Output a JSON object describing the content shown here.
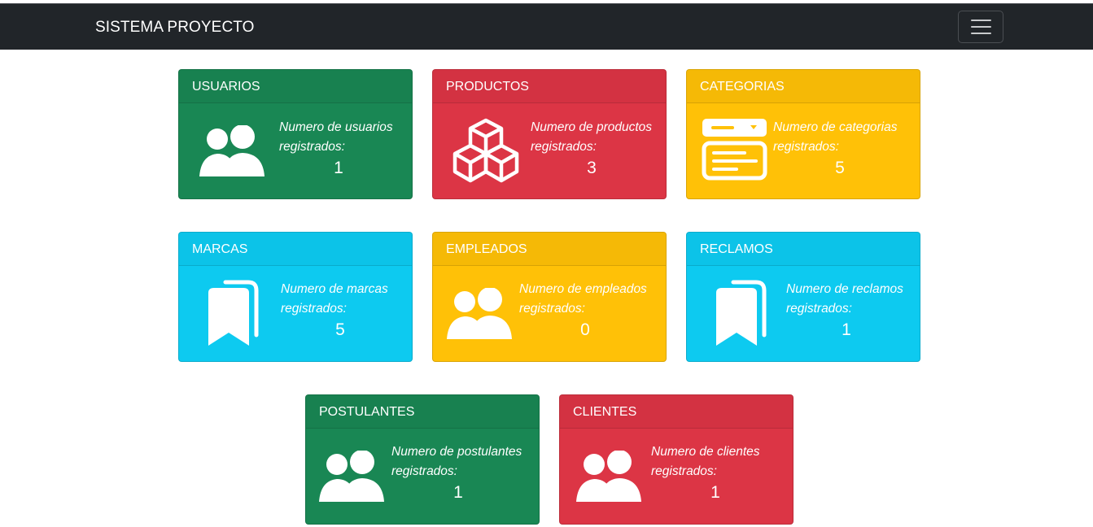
{
  "app": {
    "brand": "SISTEMA PROYECTO",
    "menu_icon": "hamburger-icon"
  },
  "colors": {
    "navbar": "#212529",
    "green": "#198754",
    "red": "#dc3545",
    "yellow": "#ffc107",
    "cyan": "#0dcaf0"
  },
  "cards": {
    "usuarios": {
      "title": "USUARIOS",
      "desc": "Numero de usuarios registrados:",
      "count": "1",
      "icon": "users-icon"
    },
    "productos": {
      "title": "PRODUCTOS",
      "desc": "Numero de productos registrados:",
      "count": "3",
      "icon": "boxes-icon"
    },
    "categorias": {
      "title": "CATEGORIAS",
      "desc": "Numero de categorias registrados:",
      "count": "5",
      "icon": "dropdown-list-icon"
    },
    "marcas": {
      "title": "MARCAS",
      "desc": "Numero de marcas registrados:",
      "count": "5",
      "icon": "bookmarks-icon"
    },
    "empleados": {
      "title": "EMPLEADOS",
      "desc": "Numero de empleados registrados:",
      "count": "0",
      "icon": "users-icon"
    },
    "reclamos": {
      "title": "RECLAMOS",
      "desc": "Numero de reclamos registrados:",
      "count": "1",
      "icon": "bookmarks-icon"
    },
    "postulantes": {
      "title": "POSTULANTES",
      "desc": "Numero de postulantes registrados:",
      "count": "1",
      "icon": "users-icon"
    },
    "clientes": {
      "title": "CLIENTES",
      "desc": "Numero de clientes registrados:",
      "count": "1",
      "icon": "users-icon"
    }
  }
}
